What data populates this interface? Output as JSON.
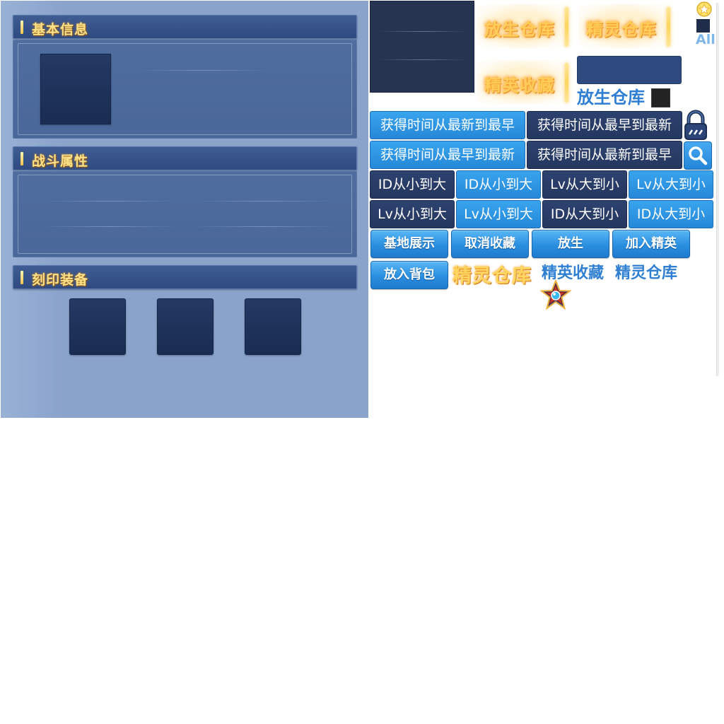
{
  "left_panel": {
    "basic_info": {
      "title": "基本信息"
    },
    "battle_attributes": {
      "title": "战斗属性"
    },
    "imprint_equipment": {
      "title": "刻印装备"
    }
  },
  "tabs": {
    "release_warehouse_glow": "放生仓库",
    "spirit_warehouse_glow": "精灵仓库",
    "elite_collection_glow": "精英收藏",
    "release_warehouse_blue": "放生仓库",
    "all_label": "All"
  },
  "sort_buttons": {
    "row1": [
      "获得时间从最新到最早",
      "获得时间从最早到最新"
    ],
    "row2": [
      "获得时间从最早到最新",
      "获得时间从最新到最早"
    ],
    "row3": [
      "ID从小到大",
      "ID从小到大",
      "Lv从大到小",
      "Lv从大到小"
    ],
    "row4": [
      "Lv从小到大",
      "Lv从小到大",
      "ID从大到小",
      "ID从大到小"
    ]
  },
  "action_buttons": {
    "base_display": "基地展示",
    "cancel_collection": "取消收藏",
    "release": "放生",
    "add_elite": "加入精英",
    "add_to_bag": "放入背包"
  },
  "labels": {
    "spirit_warehouse_gold": "精灵仓库",
    "elite_collection_blue": "精英收藏",
    "spirit_warehouse_blue": "精灵仓库"
  },
  "colors": {
    "panel_bg": "#8aa3cb",
    "header_bg": "#2e4a81",
    "title_gold": "#fbe38a",
    "button_blue": "#2a8fe0",
    "button_dark": "#24375f"
  },
  "icons": [
    "star-badge-icon",
    "lock-icon",
    "search-icon",
    "star-emblem-icon"
  ]
}
